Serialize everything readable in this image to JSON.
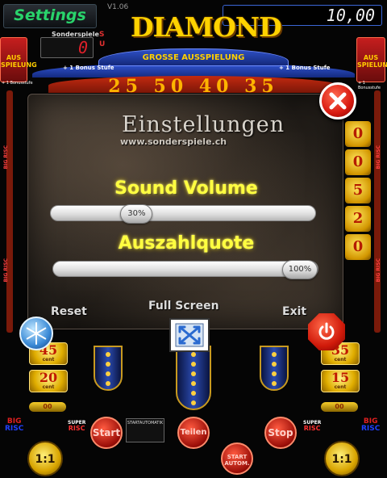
{
  "header": {
    "settings_label": "Settings",
    "version": "V1.06",
    "sonderspiele_label": "Sonderspiele",
    "sonderspiele_value": "0",
    "s_letter": "S",
    "u_letter": "U",
    "credit_value": "10,00"
  },
  "machine": {
    "title": "DIAMOND",
    "arch_text": "GROSSE AUSSPIELUNG",
    "bonus_left": "+ 1 Bonus Stufe",
    "bonus_right": "+ 1 Bonus Stufe",
    "numbers_band": "25 50 40 35",
    "side_left": "AUS SPIELUNG",
    "side_right": "AUS SPIELUNG",
    "side_sub_left": "+ 1 Bonusstufe",
    "side_sub_right": "+ 1 Bonusstufe",
    "big_risc": "BIG RISC",
    "ladder": [
      "0",
      "0",
      "5",
      "2",
      "0"
    ],
    "cent_45": "45",
    "cent_20": "20",
    "cent_35": "35",
    "cent_15": "15",
    "cent_unit": "cent",
    "zero_left": "00",
    "zero_right": "00",
    "start_label": "Start",
    "teilen_label": "Teilen",
    "stop_label": "Stop",
    "startautomatik_label": "STARTAUTOMATIK",
    "start_autom_label": "START AUTOM.",
    "one_one": "1:1",
    "big_logo_top": "BIG",
    "big_logo_bottom": "RISC",
    "super_top": "SUPER",
    "super_bottom": "RISC"
  },
  "dialog": {
    "title": "Einstellungen",
    "url": "www.sonderspiele.ch",
    "sound_heading": "Sound Volume",
    "sound_value": "30%",
    "sound_fraction": 0.3,
    "quote_heading": "Auszahlquote",
    "quote_value": "100%",
    "quote_fraction": 1.0,
    "reset_label": "Reset",
    "fullscreen_label": "Full Screen",
    "exit_label": "Exit"
  },
  "icons": {
    "close": "close-icon",
    "snowflake": "snowflake-icon",
    "fullscreen": "fullscreen-icon",
    "power": "power-icon"
  },
  "colors": {
    "accent_yellow": "#ffff40",
    "settings_green": "#29d36b",
    "close_red": "#d81a10",
    "credit_border": "#3b66d6"
  }
}
